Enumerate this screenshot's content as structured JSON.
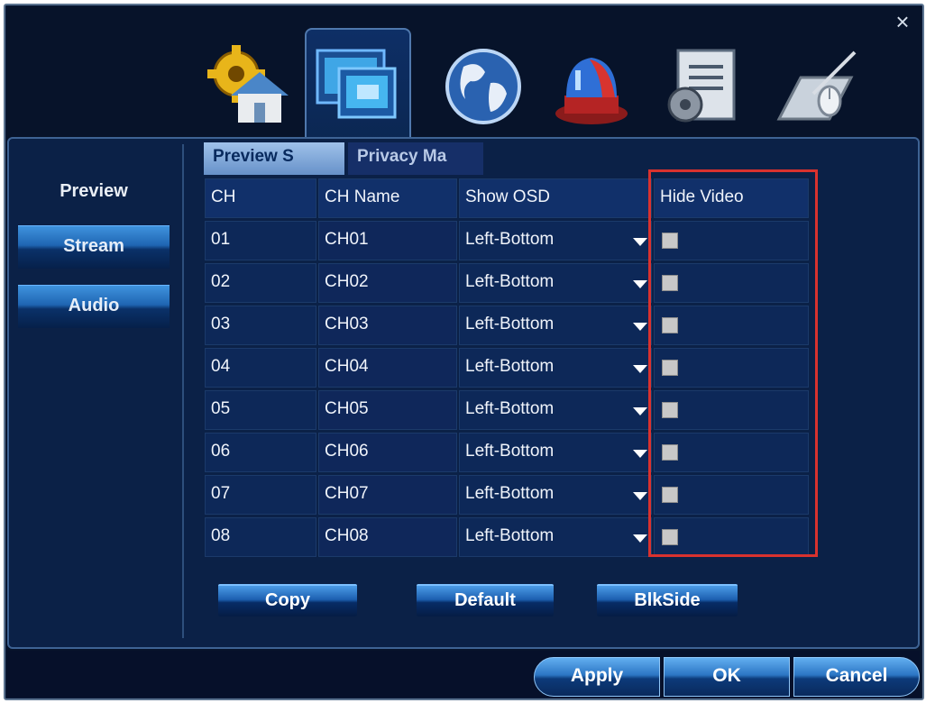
{
  "window": {
    "close_label": "×"
  },
  "toolbar_icons": [
    {
      "name": "system-settings-icon",
      "label": ""
    },
    {
      "name": "display-icon",
      "label": ""
    },
    {
      "name": "network-globe-icon",
      "label": ""
    },
    {
      "name": "alarm-siren-icon",
      "label": ""
    },
    {
      "name": "advanced-settings-icon",
      "label": ""
    },
    {
      "name": "camera-control-icon",
      "label": ""
    }
  ],
  "sidebar": {
    "items": [
      {
        "label": "Preview"
      },
      {
        "label": "Stream"
      },
      {
        "label": "Audio"
      }
    ]
  },
  "subtabs": {
    "preview": "Preview S",
    "privacy": "Privacy Ma"
  },
  "table": {
    "headers": [
      "CH",
      "CH Name",
      "Show OSD",
      "Hide Video"
    ],
    "rows": [
      {
        "ch": "01",
        "name": "CH01",
        "osd": "Left-Bottom",
        "hide": false
      },
      {
        "ch": "02",
        "name": "CH02",
        "osd": "Left-Bottom",
        "hide": false
      },
      {
        "ch": "03",
        "name": "CH03",
        "osd": "Left-Bottom",
        "hide": false
      },
      {
        "ch": "04",
        "name": "CH04",
        "osd": "Left-Bottom",
        "hide": false
      },
      {
        "ch": "05",
        "name": "CH05",
        "osd": "Left-Bottom",
        "hide": false
      },
      {
        "ch": "06",
        "name": "CH06",
        "osd": "Left-Bottom",
        "hide": false
      },
      {
        "ch": "07",
        "name": "CH07",
        "osd": "Left-Bottom",
        "hide": false
      },
      {
        "ch": "08",
        "name": "CH08",
        "osd": "Left-Bottom",
        "hide": false
      }
    ]
  },
  "panel_buttons": {
    "copy": "Copy",
    "default": "Default",
    "blkside": "BlkSide"
  },
  "footer": {
    "apply": "Apply",
    "ok": "OK",
    "cancel": "Cancel"
  },
  "colors": {
    "highlight": "#d9322e",
    "accent": "#1f65b2"
  }
}
